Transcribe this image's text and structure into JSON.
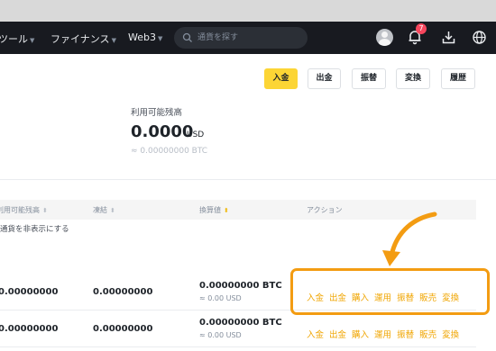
{
  "nav": {
    "items": [
      {
        "label": "ツール"
      },
      {
        "label": "ファイナンス"
      },
      {
        "label": "Web3"
      }
    ],
    "search_placeholder": "通貨を探す",
    "notification_count": "7"
  },
  "buttons": {
    "deposit": "入金",
    "withdraw": "出金",
    "transfer": "振替",
    "convert": "変換",
    "history": "履歴"
  },
  "balance": {
    "label": "利用可能残高",
    "amount": "0.0000",
    "unit": "USD",
    "btc": "≈ 0.00000000 BTC"
  },
  "hide_small_label": "通貨を非表示にする",
  "table": {
    "headers": {
      "available": "利用可能残高",
      "frozen": "凍結",
      "value": "換算値",
      "action": "アクション"
    },
    "rows": [
      {
        "available": "0.00000000",
        "frozen": "0.00000000",
        "value_btc": "0.00000000 BTC",
        "value_usd": "≈ 0.00 USD"
      },
      {
        "available": "0.00000000",
        "frozen": "0.00000000",
        "value_btc": "0.00000000 BTC",
        "value_usd": "≈ 0.00 USD"
      }
    ],
    "actions": [
      "入金",
      "出金",
      "購入",
      "運用",
      "振替",
      "販売",
      "変換"
    ]
  },
  "colors": {
    "brand_yellow": "#fcd535",
    "action_orange": "#f0a500",
    "highlight": "#f39c12",
    "nav_bg": "#181a20"
  }
}
